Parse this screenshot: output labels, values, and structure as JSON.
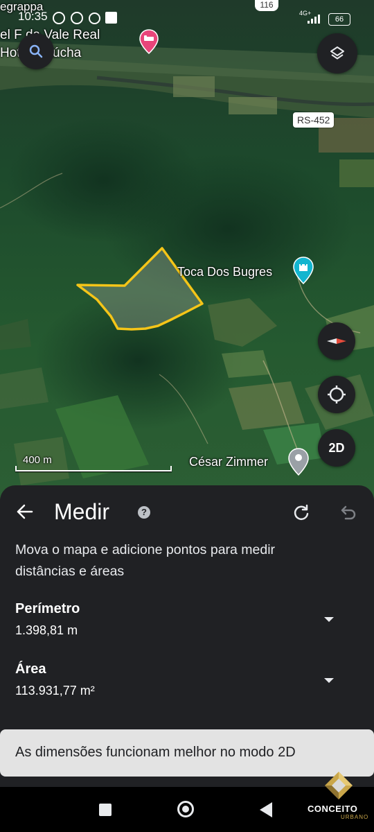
{
  "status_bar": {
    "time": "10:35",
    "network": "4G+",
    "battery": "66"
  },
  "map": {
    "top_label_fragment": "egrappa",
    "highway_shield": "116",
    "hotel_line1": "el F  da Vale Real",
    "hotel_line2": "Hot   a Gaúcha",
    "road_label": "RS-452",
    "poi_toca": "Toca Dos Bugres",
    "poi_cesar": "César Zimmer",
    "scale": "400 m",
    "view_mode": "2D"
  },
  "measure": {
    "title": "Medir",
    "instructions": "Mova o mapa e adicione pontos para medir distâncias e áreas",
    "perimeter_label": "Perímetro",
    "perimeter_value": "1.398,81 m",
    "area_label": "Área",
    "area_value": "113.931,77 m²"
  },
  "toast": {
    "text": "As dimensões funcionam melhor no modo 2D"
  },
  "watermark": {
    "brand": "CONCEITO",
    "sub": "URBANO"
  },
  "colors": {
    "polygon": "#f5c518",
    "sheet_bg": "#202124",
    "hotel_pin": "#e8457a",
    "poi_pin": "#13b5cf"
  }
}
